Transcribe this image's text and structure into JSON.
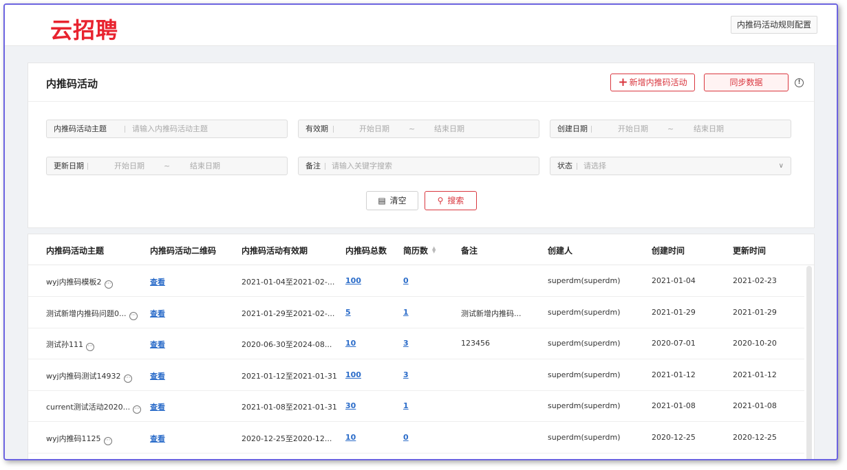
{
  "header": {
    "logo": "云招聘",
    "rule_config_button": "内推码活动规则配置"
  },
  "panel": {
    "title": "内推码活动",
    "add_button": "新增内推码活动",
    "sync_button": "同步数据",
    "info_icon": "!"
  },
  "filters": {
    "subject_label": "内推码活动主题",
    "subject_placeholder": "请输入内推码活动主题",
    "validity_label": "有效期",
    "created_label": "创建日期",
    "updated_label": "更新日期",
    "remark_label": "备注",
    "remark_placeholder": "请输入关键字搜索",
    "status_label": "状态",
    "status_placeholder": "请选择",
    "start_placeholder": "开始日期",
    "end_placeholder": "结束日期",
    "range_separator": "~"
  },
  "actions": {
    "clear": "清空",
    "search": "搜索"
  },
  "table": {
    "headers": {
      "subject": "内推码活动主题",
      "qrcode": "内推码活动二维码",
      "validity": "内推码活动有效期",
      "total": "内推码总数",
      "resumes": "简历数",
      "remark": "备注",
      "creator": "创建人",
      "created": "创建时间",
      "updated": "更新时间"
    },
    "rows": [
      {
        "subject": "wyj内推码模板2",
        "qrcode": "查看",
        "validity": "2021-01-04至2021-02-...",
        "total": "100",
        "resumes": "0",
        "remark": "",
        "creator": "superdm(superdm)",
        "created": "2021-01-04",
        "updated": "2021-02-23"
      },
      {
        "subject": "测试新增内推码问题0...",
        "qrcode": "查看",
        "validity": "2021-01-29至2021-02-...",
        "total": "5",
        "resumes": "1",
        "remark": "测试新增内推码...",
        "creator": "superdm(superdm)",
        "created": "2021-01-29",
        "updated": "2021-01-29"
      },
      {
        "subject": "测试孙111",
        "qrcode": "查看",
        "validity": "2020-06-30至2024-08...",
        "total": "10",
        "resumes": "3",
        "remark": "123456",
        "creator": "superdm(superdm)",
        "created": "2020-07-01",
        "updated": "2020-10-20"
      },
      {
        "subject": "wyj内推码测试14932",
        "qrcode": "查看",
        "validity": "2021-01-12至2021-01-31",
        "total": "100",
        "resumes": "3",
        "remark": "",
        "creator": "superdm(superdm)",
        "created": "2021-01-12",
        "updated": "2021-01-12"
      },
      {
        "subject": "current测试活动2020...",
        "qrcode": "查看",
        "validity": "2021-01-08至2021-01-31",
        "total": "30",
        "resumes": "1",
        "remark": "",
        "creator": "superdm(superdm)",
        "created": "2021-01-08",
        "updated": "2021-01-08"
      },
      {
        "subject": "wyj内推码1125",
        "qrcode": "查看",
        "validity": "2020-12-25至2020-12...",
        "total": "10",
        "resumes": "0",
        "remark": "",
        "creator": "superdm(superdm)",
        "created": "2020-12-25",
        "updated": "2020-12-25"
      }
    ]
  },
  "colors": {
    "brand_red": "#e8232f",
    "link_blue": "#2b6cc9",
    "frame_border": "#6b63e0"
  }
}
